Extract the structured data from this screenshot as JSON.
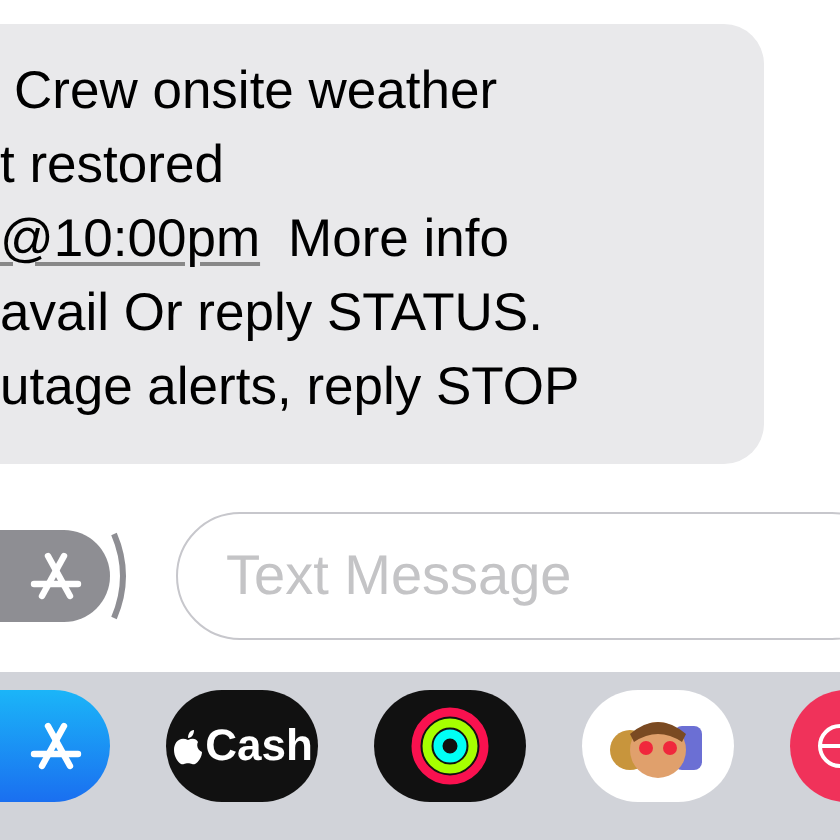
{
  "message": {
    "lines": [
      {
        "text": "Crew onsite weather"
      },
      {
        "text": "t restored"
      },
      {
        "link": "@10:00pm",
        "text": "More info"
      },
      {
        "text": "avail Or reply STATUS."
      },
      {
        "text": "utage alerts, reply STOP"
      }
    ]
  },
  "composer": {
    "placeholder": "Text Message"
  },
  "app_drawer": {
    "apps": [
      {
        "kind": "app-store"
      },
      {
        "kind": "cash",
        "label": "Cash"
      },
      {
        "kind": "activity"
      },
      {
        "kind": "memoji"
      },
      {
        "kind": "red-app"
      }
    ]
  }
}
